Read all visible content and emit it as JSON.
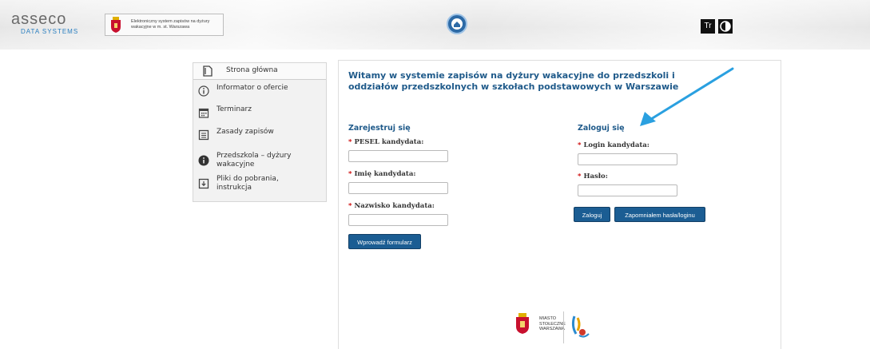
{
  "header": {
    "logo_text": "asseco",
    "logo_sub": "DATA SYSTEMS",
    "system_title": "Elektroniczny system zapisów na dyżury wakacyjne w m. st. Warszawa",
    "font_button_label": "Tr"
  },
  "sidebar": {
    "home_label": "Strona główna",
    "items": [
      {
        "label": "Informator o ofercie",
        "icon": "info-outline-icon"
      },
      {
        "label": "Terminarz",
        "icon": "calendar-icon"
      },
      {
        "label": "Zasady zapisów",
        "icon": "list-icon"
      },
      {
        "label": "Przedszkola – dyżury wakacyjne",
        "icon": "info-filled-icon"
      },
      {
        "label": "Pliki do pobrania, instrukcja",
        "icon": "download-icon"
      }
    ]
  },
  "main": {
    "title": "Witamy w systemie zapisów na dyżury wakacyjne do przedszkoli i oddziałów przedszkolnych w szkołach podstawowych w Warszawie",
    "register": {
      "heading": "Zarejestruj się",
      "pesel_label": "PESEL kandydata:",
      "pesel_value": "",
      "first_name_label": "Imię kandydata:",
      "first_name_value": "",
      "last_name_label": "Nazwisko kandydata:",
      "last_name_value": "",
      "submit_label": "Wprowadź formularz"
    },
    "login": {
      "heading": "Zaloguj się",
      "login_label": "Login kandydata:",
      "login_value": "",
      "password_label": "Hasło:",
      "password_value": "",
      "login_button": "Zaloguj",
      "forgot_button": "Zapomniałem hasła/loginu"
    },
    "required_mark": "*",
    "footer_city": "MIASTO STOŁECZNE WARSZAWA"
  },
  "colors": {
    "accent": "#1f5a8a",
    "button": "#1b5d93",
    "required": "#cc0000",
    "annotation_arrow": "#2aa0e0"
  }
}
